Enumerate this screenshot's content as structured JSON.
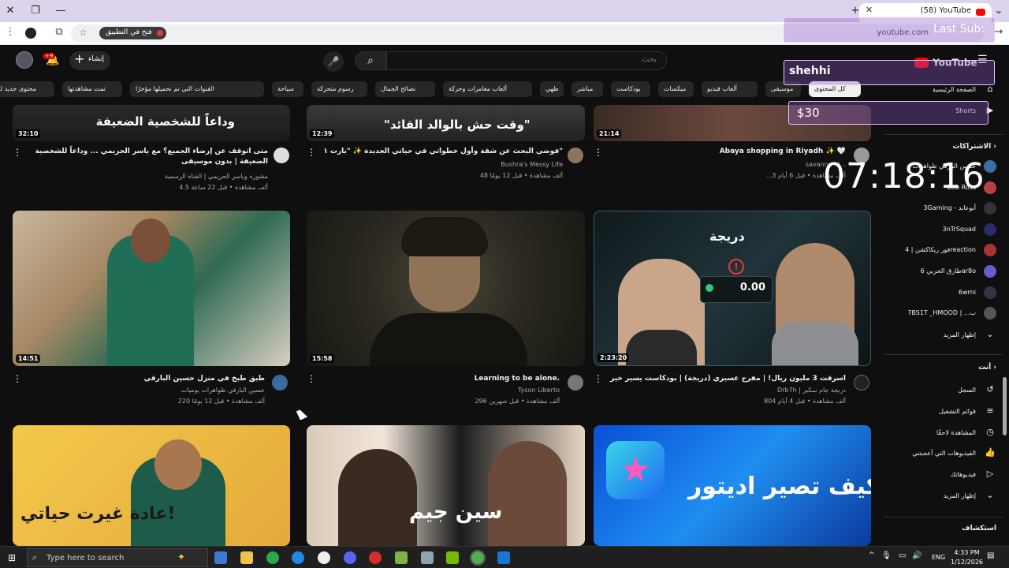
{
  "browser": {
    "tab_title": "(58) YouTube",
    "open_in_app": "فتح في التطبيق",
    "url": "youtube.com"
  },
  "masthead": {
    "search_placeholder": "بحث",
    "create_label": "إنشاء",
    "bell_badge": "+9",
    "logo_text": "YouTube"
  },
  "chips": [
    {
      "label": "كل المحتوى",
      "active": true
    },
    {
      "label": "موسيقى"
    },
    {
      "label": "ألعاب فيديو"
    },
    {
      "label": "ميكسات"
    },
    {
      "label": "بودكاست"
    },
    {
      "label": "مباشر"
    },
    {
      "label": "طهي"
    },
    {
      "label": "ألعاب مغامرات وحركة"
    },
    {
      "label": "نصائح الجمال"
    },
    {
      "label": "رسوم متحركة"
    },
    {
      "label": "سياحة"
    },
    {
      "label": "القنوات التي تم تحميلها مؤخرًا"
    },
    {
      "label": "تمت مشاهدتها"
    },
    {
      "label": "محتوى جديد لك"
    }
  ],
  "videos": [
    {
      "title": "متى اتوقف عن إرضاء الجميع؟ مع ياسر الحزيمي ... وداعاً للشخصية الضعيفة | بدون موسيقى",
      "channel": "مشورة وياسر الحزيمي | القناة الرسمية",
      "meta": "4.5 ألف مشاهدة • قبل 22 ساعة",
      "duration": "32:10",
      "thumb_text": "وداعاً للشخصية الضعيفة"
    },
    {
      "title": "فوضى البحث عن شقة وأول خطواتي في حياتي الجديدة ✨ \"بارت ١\"",
      "channel": "Bushra's Messy Life",
      "meta": "48 ألف مشاهدة • قبل 12 يومًا",
      "duration": "12:39",
      "thumb_text": "\"وقت حش بالوالد القائد\""
    },
    {
      "title": "Abaya shopping in Riyadh ✨ 🤍",
      "channel": "savanna al...",
      "meta": "...3 ألف مشاهدة • قبل 6 أيام",
      "duration": "21:14",
      "thumb_text": ""
    },
    {
      "title": "طبق طبخ في منزل حسين البارقي",
      "channel": "حسين البارقي ظواهرات يوميات",
      "meta": "220 ألف مشاهدة • قبل 12 يومًا",
      "duration": "14:51",
      "thumb_text": ""
    },
    {
      "title": "Learning to be alone.",
      "channel": "Tyson Liberto",
      "meta": "296 ألف مشاهدة • قبل شهرين",
      "duration": "15:58",
      "thumb_text": ""
    },
    {
      "title": "اسرقت 3 مليون ريال! | مفرج عسيري (دريجة) | بودكاست يسير خير",
      "channel": "Drb7h | دريجة",
      "meta": "804 ألف مشاهدة • قبل 4 أيام",
      "duration": "2:23:20",
      "thumb_text": "0.00",
      "channel_prefix": "جام سكير"
    },
    {
      "title": "",
      "channel": "",
      "meta": "",
      "duration": "",
      "thumb_text": "عادة غيرت حياتي!"
    },
    {
      "title": "",
      "channel": "",
      "meta": "",
      "duration": "",
      "thumb_text": "سين جيم"
    },
    {
      "title": "",
      "channel": "",
      "meta": "",
      "duration": "",
      "thumb_text": "كيف تصير اديتور"
    }
  ],
  "sidebar": {
    "home": "الصفحة الرئيسية",
    "shorts": "Shorts",
    "subs_heading": "الاشتراكات",
    "subs": [
      {
        "label": "حسين البارقي ظواهرات"
      },
      {
        "label": "Bob Ross"
      },
      {
        "label": "3Gaming - أبوعابد"
      },
      {
        "label": "3nTrSquad"
      },
      {
        "label": "فور ريكاكشن | 4reaction"
      },
      {
        "label": "طارق الحربي 6ar8o"
      },
      {
        "label": "6wrni"
      },
      {
        "label": "7BS1T _HMOOD | ...ب"
      }
    ],
    "show_more": "إظهار المزيد",
    "you_heading": "أنت",
    "you_items": [
      {
        "label": "السجل",
        "icon": "history-icon"
      },
      {
        "label": "قوائم التشغيل",
        "icon": "playlists-icon"
      },
      {
        "label": "المشاهدة لاحقًا",
        "icon": "watch-later-icon"
      },
      {
        "label": "الفيديوهات التي أعجبتني",
        "icon": "thumbs-up-icon"
      },
      {
        "label": "فيديوهاتك",
        "icon": "your-videos-icon"
      },
      {
        "label": "إظهار المزيد",
        "icon": "chevron-down-icon"
      }
    ],
    "explore_heading": "استكشاف"
  },
  "overlay": {
    "title": "shehhi",
    "money": "$30",
    "clock": "07:18:16",
    "last_sub": "Last Sub:"
  },
  "taskbar": {
    "search_placeholder": "Type here to search",
    "time": "4:33 PM",
    "date": "1/12/2026",
    "lang": "ENG"
  },
  "colors": {
    "accent": "#ff0000",
    "bg": "#0f0f0f"
  }
}
